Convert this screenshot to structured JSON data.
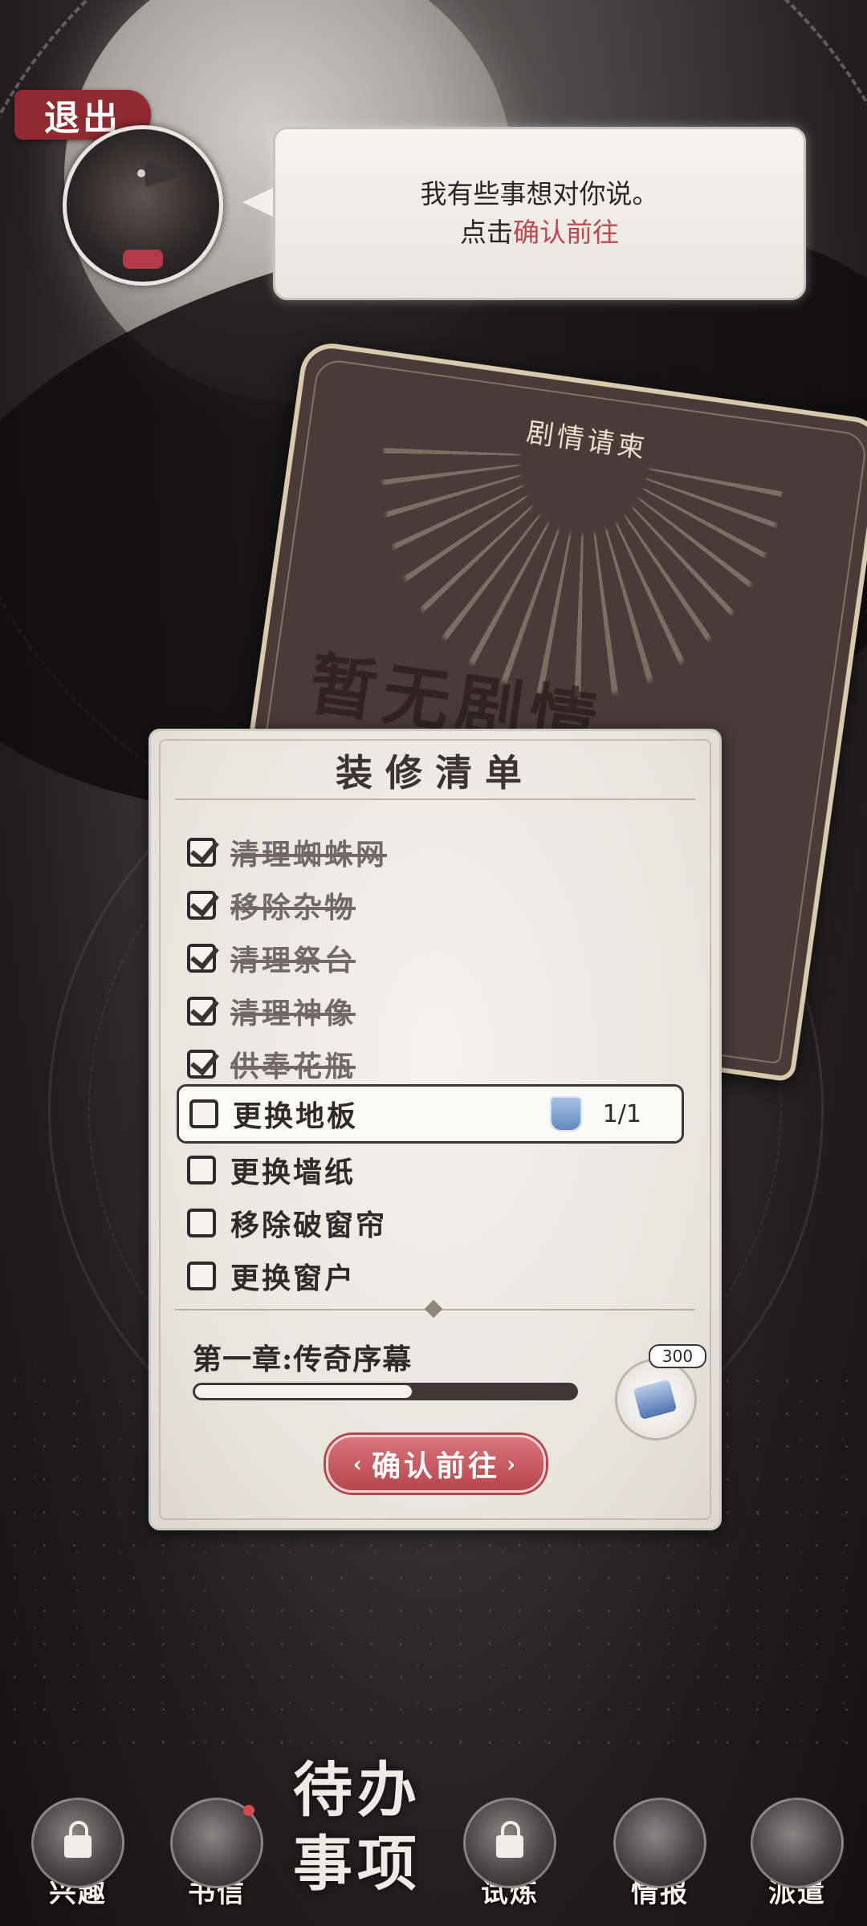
{
  "top": {
    "exit_label": "退出",
    "dialogue_line1": "我有些事想对你说。",
    "dialogue_line2_prefix": "点击",
    "dialogue_line2_highlight": "确认前往"
  },
  "story_card": {
    "title": "剧情请柬",
    "body_text": "暂无剧情"
  },
  "checklist": {
    "title": "装修清单",
    "tasks": [
      {
        "label": "清理蜘蛛网",
        "done": true
      },
      {
        "label": "移除杂物",
        "done": true
      },
      {
        "label": "清理祭台",
        "done": true
      },
      {
        "label": "清理神像",
        "done": true
      },
      {
        "label": "供奉花瓶",
        "done": true
      },
      {
        "label": "更换地板",
        "done": false,
        "requirement": "1/1",
        "requirement_icon": "shield-material-icon"
      },
      {
        "label": "更换墙纸",
        "done": false
      },
      {
        "label": "移除破窗帘",
        "done": false
      },
      {
        "label": "更换窗户",
        "done": false
      }
    ],
    "chapter": "第一章:传奇序幕",
    "progress_fraction": 0.57,
    "reward_count": "300",
    "reward_icon": "book-reward-icon",
    "confirm_label": "确认前往"
  },
  "bottom_nav": {
    "items": [
      {
        "label": "兴趣",
        "locked": true,
        "icon": "interest-icon"
      },
      {
        "label": "书信",
        "locked": false,
        "icon": "letter-icon",
        "notification": true
      },
      {
        "label": "试炼",
        "locked": true,
        "icon": "trial-icon"
      },
      {
        "label": "情报",
        "locked": false,
        "icon": "intel-icon"
      },
      {
        "label": "派遣",
        "locked": false,
        "icon": "dispatch-icon"
      }
    ],
    "center_logo_line1": "待办",
    "center_logo_line2": "事项"
  },
  "colors": {
    "accent_red": "#c0484f",
    "panel_bg": "#f4f2ec",
    "card_brown": "#4a3b38"
  }
}
